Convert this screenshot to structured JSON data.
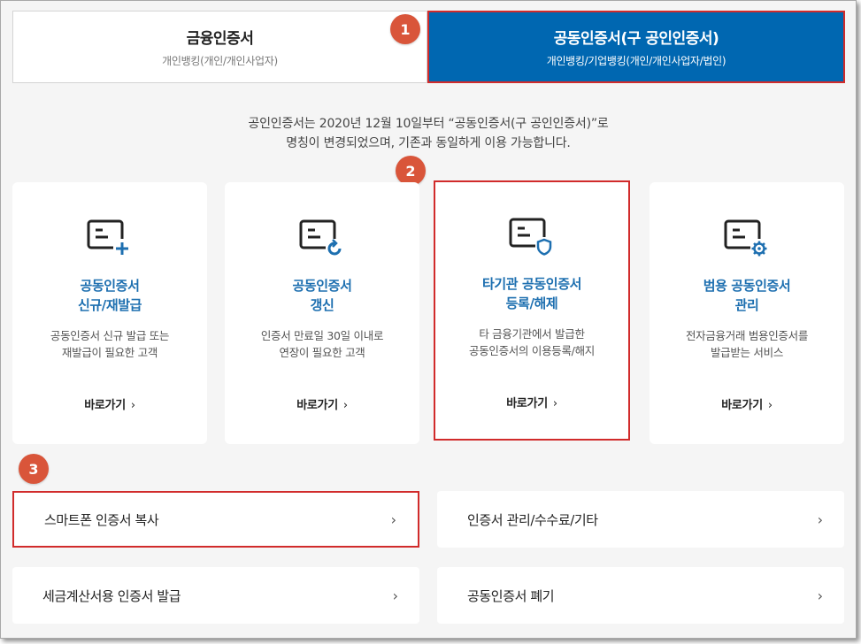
{
  "tabs": [
    {
      "title": "금융인증서",
      "sub": "개인뱅킹(개인/개인사업자)"
    },
    {
      "title": "공동인증서(구 공인인증서)",
      "sub": "개인뱅킹/기업뱅킹(개인/개인사업자/법인)"
    }
  ],
  "badges": [
    "1",
    "2",
    "3"
  ],
  "notice": {
    "line1": "공인인증서는 2020년 12월 10일부터 “공동인증서(구 공인인증서)”로",
    "line2": "명칭이 변경되었으며, 기존과 동일하게 이용 가능합니다."
  },
  "cards": [
    {
      "icon": "certificate-add-icon",
      "title1": "공동인증서",
      "title2": "신규/재발급",
      "desc1": "공동인증서 신규 발급 또는",
      "desc2": "재발급이 필요한 고객",
      "link": "바로가기"
    },
    {
      "icon": "certificate-renew-icon",
      "title1": "공동인증서",
      "title2": "갱신",
      "desc1": "인증서 만료일 30일 이내로",
      "desc2": "연장이 필요한 고객",
      "link": "바로가기"
    },
    {
      "icon": "certificate-shield-icon",
      "title1": "타기관 공동인증서",
      "title2": "등록/해제",
      "desc1": "타 금융기관에서 발급한",
      "desc2": "공동인증서의 이용등록/해지",
      "link": "바로가기"
    },
    {
      "icon": "certificate-gear-icon",
      "title1": "범용 공동인증서",
      "title2": "관리",
      "desc1": "전자금융거래 범용인증서를",
      "desc2": "발급받는 서비스",
      "link": "바로가기"
    }
  ],
  "rows": [
    {
      "label": "스마트폰 인증서 복사"
    },
    {
      "label": "인증서 관리/수수료/기타"
    },
    {
      "label": "세금계산서용 인증서 발급"
    },
    {
      "label": "공동인증서 폐기"
    }
  ],
  "chevron": "›",
  "colors": {
    "accent": "#0067b1",
    "title_blue": "#1d6fb0",
    "highlight_red": "#d12b2b",
    "badge": "#d9553a",
    "background": "#f5f5f5"
  }
}
